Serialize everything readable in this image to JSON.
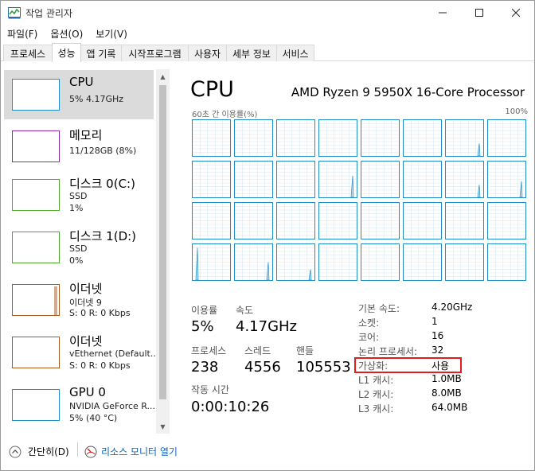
{
  "window": {
    "title": "작업 관리자"
  },
  "menu": [
    "파일(F)",
    "옵션(O)",
    "보기(V)"
  ],
  "tabs": [
    "프로세스",
    "성능",
    "앱 기록",
    "시작프로그램",
    "사용자",
    "세부 정보",
    "서비스"
  ],
  "active_tab": "성능",
  "sidebar": {
    "items": [
      {
        "name": "CPU",
        "sub1": "5% 4.17GHz",
        "sub2": "",
        "sub3": "",
        "color": "#1d8ec7",
        "selected": true
      },
      {
        "name": "메모리",
        "sub1": "11/128GB (8%)",
        "sub2": "",
        "sub3": "",
        "color": "#8b29a8",
        "selected": false
      },
      {
        "name": "디스크 0(C:)",
        "sub1": "SSD",
        "sub2": "1%",
        "sub3": "",
        "color": "#4da82b",
        "selected": false
      },
      {
        "name": "디스크 1(D:)",
        "sub1": "SSD",
        "sub2": "0%",
        "sub3": "",
        "color": "#4da82b",
        "selected": false
      },
      {
        "name": "이더넷",
        "sub1": "이더넷 9",
        "sub2": "S: 0 R: 0 Kbps",
        "sub3": "",
        "color": "#a7561a",
        "selected": false
      },
      {
        "name": "이더넷",
        "sub1": "vEthernet (Default...",
        "sub2": "S: 0 R: 0 Kbps",
        "sub3": "",
        "color": "#a7561a",
        "selected": false
      },
      {
        "name": "GPU 0",
        "sub1": "NVIDIA GeForce R...",
        "sub2": "5% (40 °C)",
        "sub3": "",
        "color": "#1d8ec7",
        "selected": false
      }
    ]
  },
  "main": {
    "title": "CPU",
    "model": "AMD Ryzen 9 5950X 16-Core Processor",
    "graph_left_label": "60초 간 이용률(%)",
    "graph_right_label": "100%",
    "core_count": 32,
    "stats": {
      "util_label": "이용률",
      "util_value": "5%",
      "speed_label": "속도",
      "speed_value": "4.17GHz",
      "proc_label": "프로세스",
      "proc_value": "238",
      "threads_label": "스레드",
      "threads_value": "4556",
      "handles_label": "핸들",
      "handles_value": "105553",
      "uptime_label": "작동 시간",
      "uptime_value": "0:00:10:26"
    },
    "info": [
      {
        "label": "기본 속도:",
        "value": "4.20GHz"
      },
      {
        "label": "소켓:",
        "value": "1"
      },
      {
        "label": "코어:",
        "value": "16"
      },
      {
        "label": "논리 프로세서:",
        "value": "32"
      },
      {
        "label": "가상화:",
        "value": "사용"
      },
      {
        "label": "L1 캐시:",
        "value": "1.0MB"
      },
      {
        "label": "L2 캐시:",
        "value": "8.0MB"
      },
      {
        "label": "L3 캐시:",
        "value": "64.0MB"
      }
    ]
  },
  "footer": {
    "collapse_label": "간단히(D)",
    "monitor_label": "리소스 모니터 열기"
  }
}
